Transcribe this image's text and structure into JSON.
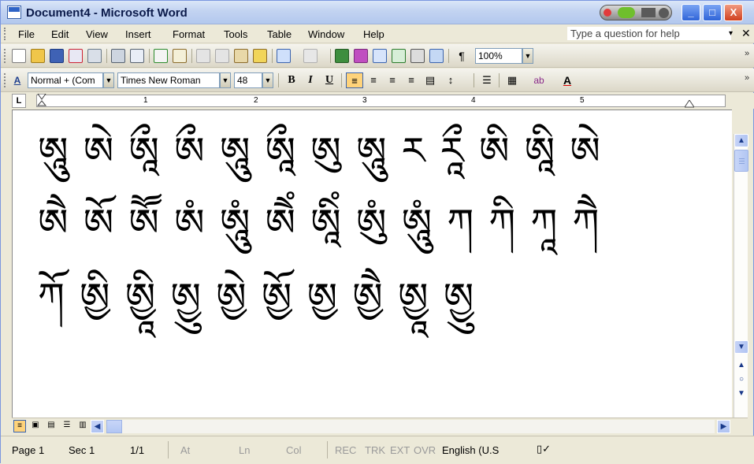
{
  "window": {
    "title": "Document4 - Microsoft Word",
    "controls": [
      "_",
      "□",
      "X"
    ]
  },
  "menu": {
    "items": [
      "File",
      "Edit",
      "View",
      "Insert",
      "Format",
      "Tools",
      "Table",
      "Window",
      "Help"
    ],
    "help_placeholder": "Type a question for help",
    "help_arrow": "▾",
    "close": "✕"
  },
  "formatting": {
    "style": "Normal + (Com",
    "font": "Times New Roman",
    "size": "48",
    "bold": "B",
    "italic": "I",
    "underline": "U",
    "zoom": "100%",
    "paragraph_mark": "¶"
  },
  "ruler": {
    "tab_selector": "L",
    "numbers": [
      "1",
      "2",
      "3",
      "4",
      "5"
    ]
  },
  "document": {
    "lines": [
      "ཨཱུ ཨེ ཨཱྀ ཨྀ ཨཱུ ཨཱྀ ཨུ ཨཱུ ཪ ཪཱྀ ཨི ཨཱི ཨེ",
      "ཨཻ ཨོ ཨཽ ཨཾ ཨཱུཾ ཨཻཾ ཨཱིཾ ཨུཾ ཨཱུཾ ཀ ཀི ཀཱ ཀཻ",
      "ཀོ ཨྱི ཨྱཱི ཨྱུ ཨྱེ ཨྱོ ཨྱ ཨྱཻ ཨྱཱ ཨྱུ"
    ]
  },
  "status": {
    "page": "Page 1",
    "sec": "Sec 1",
    "pages": "1/1",
    "at": "At",
    "ln": "Ln",
    "col": "Col",
    "rec": "REC",
    "trk": "TRK",
    "ext": "EXT",
    "ovr": "OVR",
    "language": "English (U.S"
  },
  "colors": {
    "title_bar": "#c2d3f1",
    "toolbar": "#ece9d8",
    "active_button": "#ffd37a"
  }
}
